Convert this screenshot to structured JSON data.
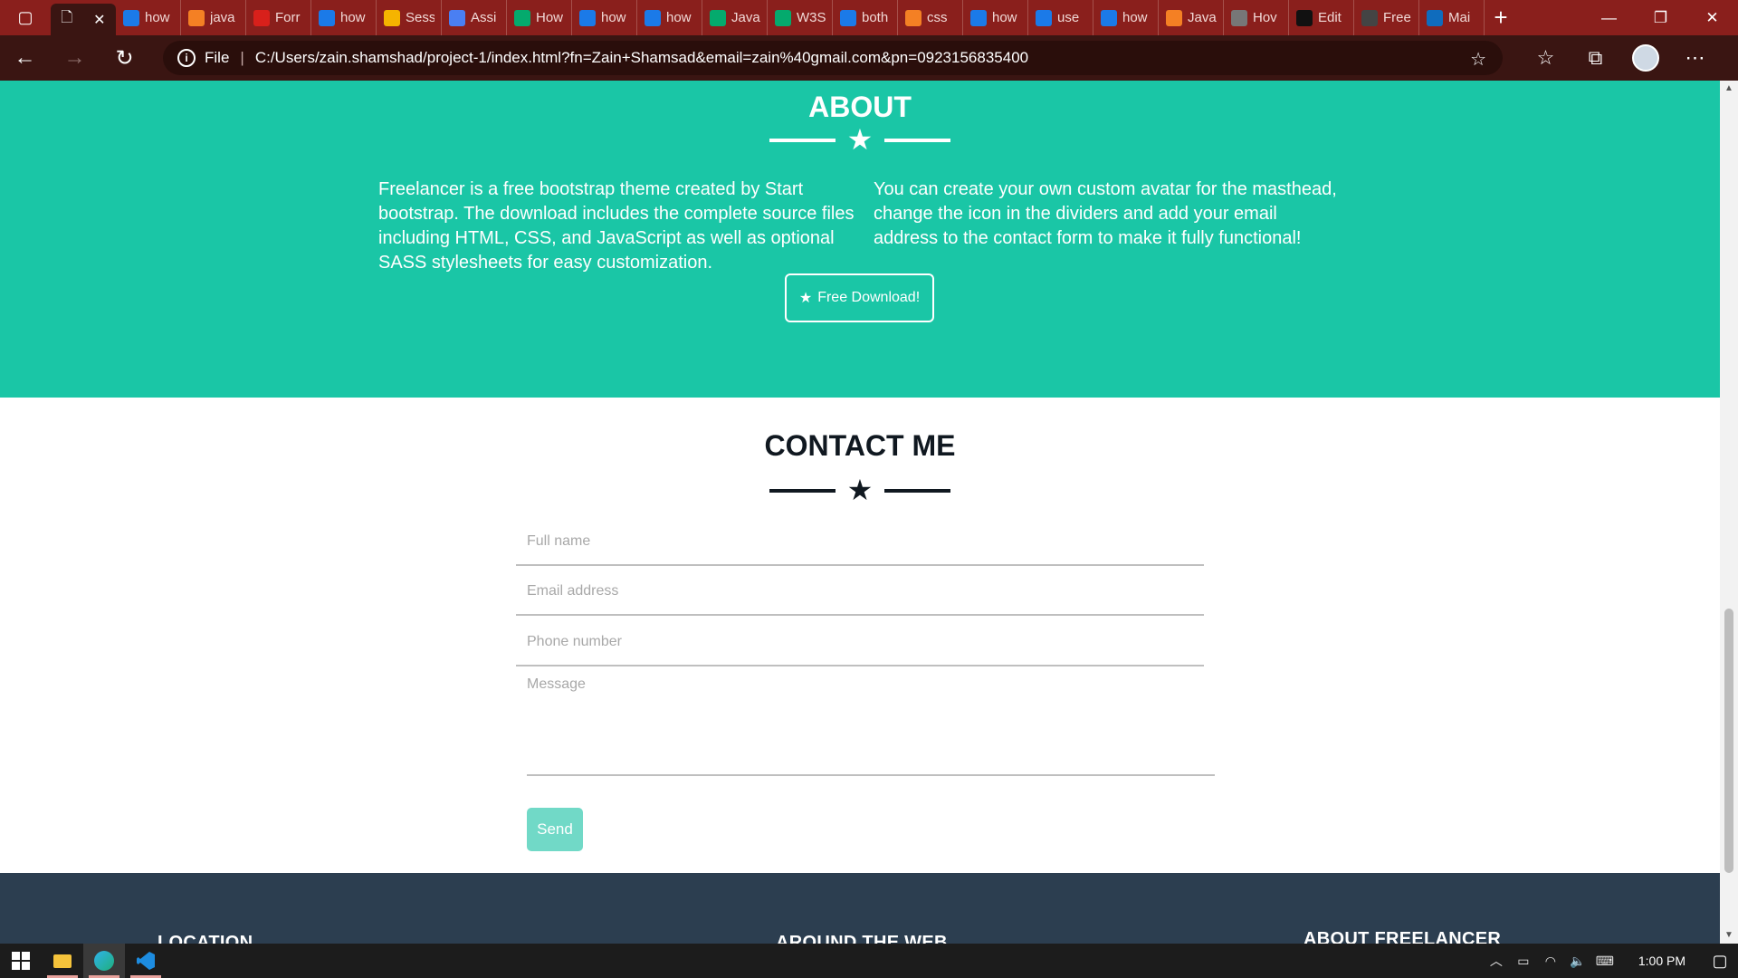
{
  "browser": {
    "tabs": [
      {
        "title": "how",
        "icon": "bing-icon",
        "color": "#1b7ae8"
      },
      {
        "title": "java",
        "icon": "stackoverflow-icon",
        "color": "#f48024"
      },
      {
        "title": "Forr",
        "icon": "adobe-icon",
        "color": "#d8201b"
      },
      {
        "title": "how",
        "icon": "bing-icon",
        "color": "#1b7ae8"
      },
      {
        "title": "Sess",
        "icon": "google-drive-icon",
        "color": "#f5b400"
      },
      {
        "title": "Assi",
        "icon": "google-docs-icon",
        "color": "#4a7ff2"
      },
      {
        "title": "How",
        "icon": "w3schools-icon",
        "color": "#04aa6d"
      },
      {
        "title": "how",
        "icon": "bing-icon",
        "color": "#1b7ae8"
      },
      {
        "title": "how",
        "icon": "bing-icon",
        "color": "#1b7ae8"
      },
      {
        "title": "Java",
        "icon": "w3schools-icon",
        "color": "#04aa6d"
      },
      {
        "title": "W3S",
        "icon": "w3schools-icon",
        "color": "#04aa6d"
      },
      {
        "title": "both",
        "icon": "bing-icon",
        "color": "#1b7ae8"
      },
      {
        "title": "css",
        "icon": "stackoverflow-icon",
        "color": "#f48024"
      },
      {
        "title": "how",
        "icon": "bing-icon",
        "color": "#1b7ae8"
      },
      {
        "title": "use",
        "icon": "bing-icon",
        "color": "#1b7ae8"
      },
      {
        "title": "how",
        "icon": "bing-icon",
        "color": "#1b7ae8"
      },
      {
        "title": "Java",
        "icon": "stackoverflow-icon",
        "color": "#f48024"
      },
      {
        "title": "Hov",
        "icon": "site-icon",
        "color": "#777777"
      },
      {
        "title": "Edit",
        "icon": "github-icon",
        "color": "#111111"
      },
      {
        "title": "Free",
        "icon": "globe-icon",
        "color": "#444444"
      },
      {
        "title": "Mai",
        "icon": "outlook-icon",
        "color": "#0f6cbd"
      }
    ],
    "address": {
      "scheme_label": "File",
      "url": "C:/Users/zain.shamshad/project-1/index.html?fn=Zain+Shamsad&email=zain%40gmail.com&pn=0923156835400"
    }
  },
  "about": {
    "title": "ABOUT",
    "left_text": "Freelancer is a free bootstrap theme created by Start bootstrap. The download includes the complete source files including HTML, CSS, and JavaScript as well as optional SASS stylesheets for easy customization.",
    "right_text": "You can create your own custom avatar for the masthead, change the icon in the dividers and add your email address to the contact form to make it fully functional!",
    "download_label": "Free Download!"
  },
  "contact": {
    "title": "CONTACT ME",
    "name_placeholder": "Full name",
    "email_placeholder": "Email address",
    "phone_placeholder": "Phone number",
    "message_placeholder": "Message",
    "send_label": "Send"
  },
  "footer": {
    "location_title": "LOCATION",
    "web_title": "AROUND THE WEB",
    "about_title": "ABOUT FREELANCER"
  },
  "taskbar": {
    "time": "1:00 PM"
  },
  "colors": {
    "accent": "#1ac6a6",
    "footer": "#2c3e50",
    "browser_frame": "#8a1f1c"
  }
}
